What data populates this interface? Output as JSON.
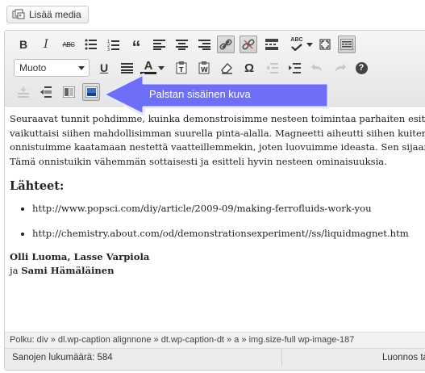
{
  "media": {
    "add_media_label": "Lisää media"
  },
  "toolbar": {
    "bold": "B",
    "italic": "I",
    "strikethrough": "ABC",
    "blockquote": "“",
    "spellcheck": "ABC",
    "format_select": "Muoto",
    "underline": "U",
    "text_color": "A",
    "special_char": "Ω",
    "help": "?"
  },
  "callout": {
    "text": "Palstan sisäinen kuva",
    "color": "#6f6ff5"
  },
  "content": {
    "paragraph_lines": [
      "Seuraavat tunnit pohdimme, kuinka demonstroisimme nesteen toimintaa parhaiten esittäisi",
      "vaikuttaisi siihen mahdollisimman suurella pinta-alalla. Magneetti aiheutti siihen kuitenkin",
      "onnistuimme kaatamaan nestettä vaatteillemmekin, joten luovuimme ideasta. Sen sijaan",
      "Tämä onnistuikin vähemmän sottaisesti ja esitteli hyvin nesteen ominaisuuksia."
    ],
    "sources_heading": "Lähteet:",
    "links": [
      "http://www.popsci.com/diy/article/2009-09/making-ferrofluids-work-you",
      "http://chemistry.about.com/od/demonstrationsexperiment//ss/liquidmagnet.htm"
    ],
    "authors_line1": "Olli Luoma, Lasse Varpiola",
    "authors_conj": "ja ",
    "authors_line2": "Sami Hämäläinen"
  },
  "path_bar": {
    "text": "Polku: div » dl.wp-caption alignnone » dt.wp-caption-dt » a » img.size-full wp-image-187"
  },
  "status": {
    "word_count": "Sanojen lukumäärä: 584",
    "draft": "Luonnos ta"
  }
}
